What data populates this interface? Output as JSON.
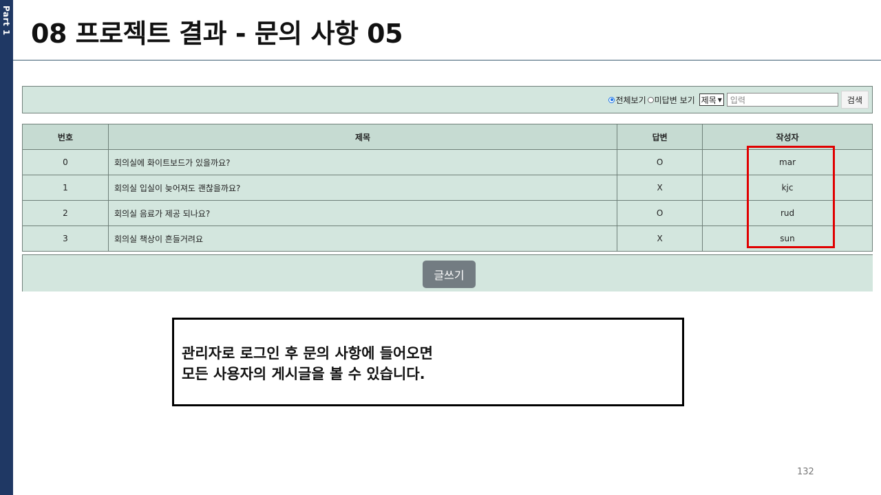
{
  "slide": {
    "side_label": "Part 1",
    "title": "08 프로젝트 결과 - 문의 사항 05",
    "page_number": "132",
    "note_line1": "관리자로 로그인 후 문의 사항에 들어오면",
    "note_line2": "모든 사용자의 게시글을 볼 수 있습니다."
  },
  "search": {
    "radio_all_label": "전체보기",
    "radio_all_checked": true,
    "radio_unanswered_label": "미답변 보기",
    "radio_unanswered_checked": false,
    "select_value": "제목",
    "input_placeholder": "입력",
    "button_label": "검색"
  },
  "board": {
    "headers": {
      "no": "번호",
      "title": "제목",
      "answer": "답변",
      "author": "작성자"
    },
    "rows": [
      {
        "no": "0",
        "title": "회의실에 화이트보드가 있을까요?",
        "answer": "O",
        "author": "mar"
      },
      {
        "no": "1",
        "title": "회의실 입실이 늦어져도 괜찮을까요?",
        "answer": "X",
        "author": "kjc"
      },
      {
        "no": "2",
        "title": "회의실 음료가 제공 되나요?",
        "answer": "O",
        "author": "rud"
      },
      {
        "no": "3",
        "title": "회의실 책상이 흔들거려요",
        "answer": "X",
        "author": "sun"
      }
    ]
  },
  "write_button_label": "글쓰기",
  "colors": {
    "sidebar": "#1f3864",
    "table_body": "#d3e6de",
    "table_header": "#c6dbd2",
    "highlight": "#e00000",
    "write_button": "#737c82"
  }
}
